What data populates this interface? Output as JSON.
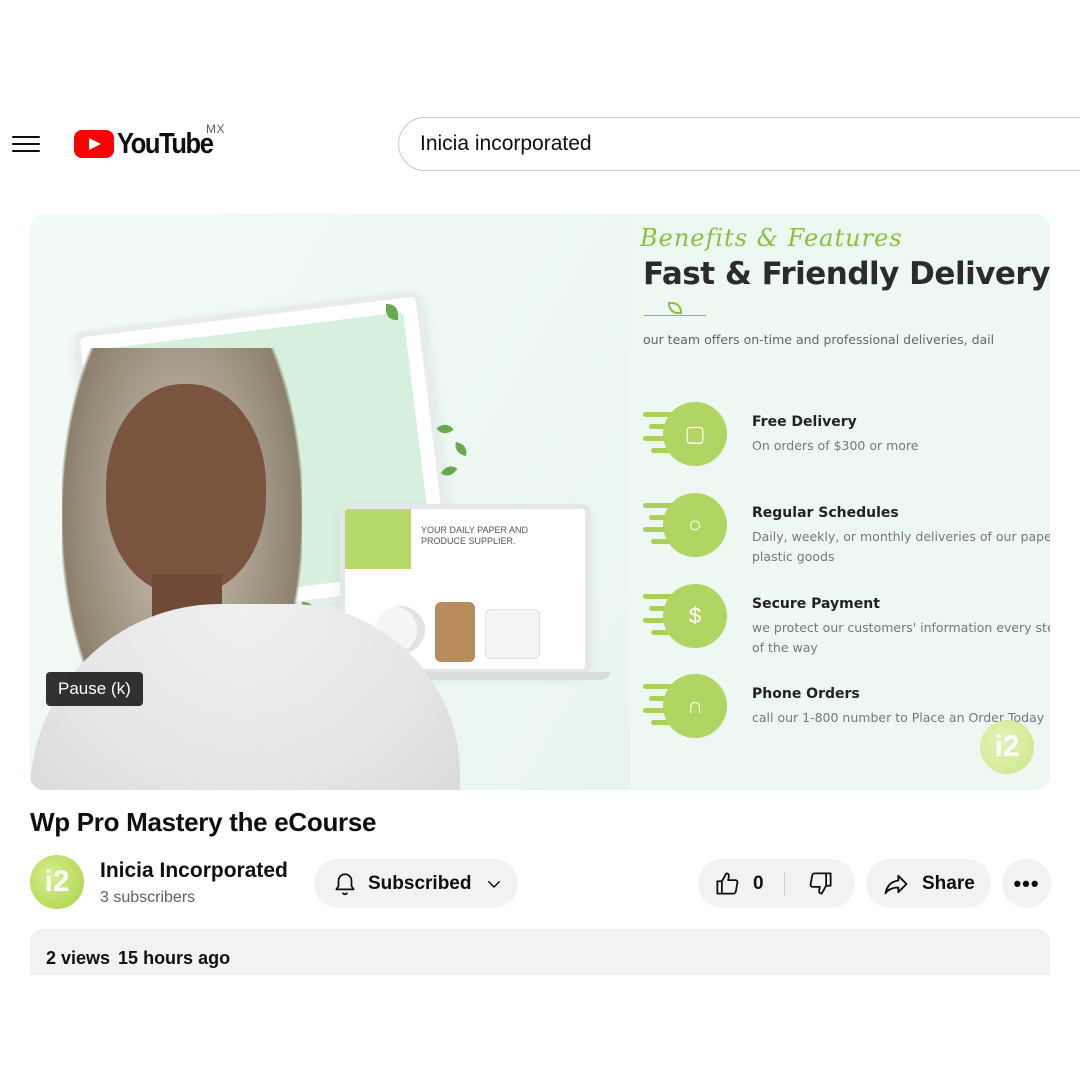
{
  "header": {
    "logo_text": "YouTube",
    "country_code": "MX",
    "search_value": "Inicia incorporated"
  },
  "player": {
    "slide": {
      "script_title": "Benefits & Features",
      "title": "Fast & Friendly Delivery",
      "tagline": "our team offers on-time and professional deliveries, dail",
      "laptop_text": "YOUR DAILY PAPER AND PRODUCE SUPPLIER.",
      "features": [
        {
          "title": "Free Delivery",
          "desc": "On orders of $300 or more",
          "icon": "box-icon"
        },
        {
          "title": "Regular Schedules",
          "desc": "Daily, weekly, or monthly deliveries of our paper plastic goods",
          "icon": "apple-icon"
        },
        {
          "title": "Secure Payment",
          "desc": "we protect our customers' information every ste of the way",
          "icon": "money-bag-icon"
        },
        {
          "title": "Phone Orders",
          "desc": "call our 1-800 number to Place an Order Today",
          "icon": "headset-icon"
        }
      ],
      "watermark": "i2"
    },
    "tooltip": "Pause (k)"
  },
  "video": {
    "title": "Wp Pro Mastery the eCourse",
    "channel": {
      "avatar_text": "i2",
      "name": "Inicia Incorporated",
      "subscribers": "3 subscribers"
    },
    "subscribe_label": "Subscribed",
    "like_count": "0",
    "share_label": "Share",
    "more_label": "•••",
    "views": "2 views",
    "posted": "15 hours ago"
  },
  "colors": {
    "brand_red": "#ff0000",
    "accent_green": "#b0d563",
    "pill_bg": "#f2f2f2"
  }
}
